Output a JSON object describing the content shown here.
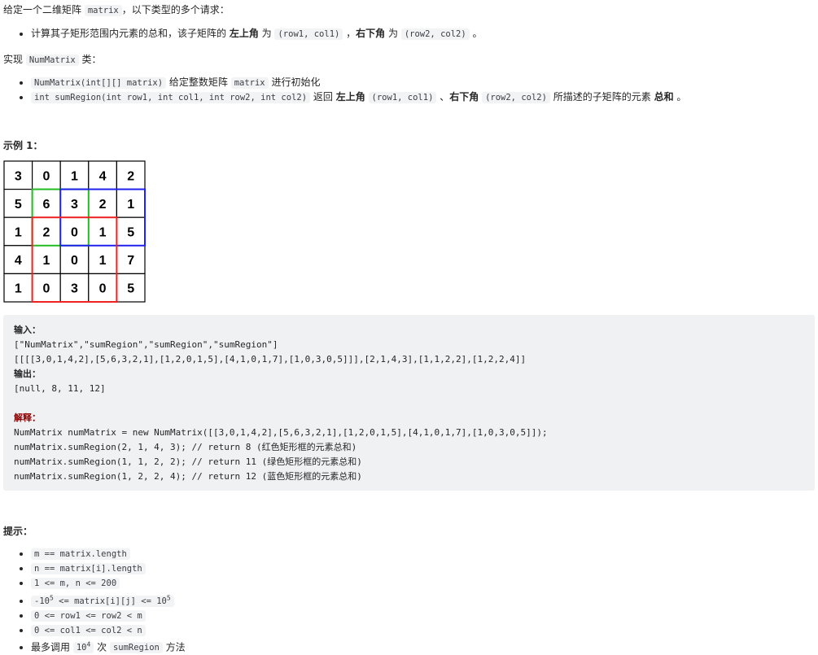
{
  "intro": {
    "pre": "给定一个二维矩阵 ",
    "code": "matrix",
    "post": "，以下类型的多个请求："
  },
  "req": {
    "t1": "计算其子矩形范围内元素的总和，该子矩阵的 ",
    "b1": "左上角",
    "t2": " 为 ",
    "c1": "(row1,  col1)",
    "t3": " ，",
    "b2": "右下角",
    "t4": " 为 ",
    "c2": "(row2,  col2)",
    "t5": " 。"
  },
  "impl": {
    "pre": "实现 ",
    "code": "NumMatrix",
    "post": " 类："
  },
  "methods": [
    {
      "code": "NumMatrix(int[][] matrix)",
      "t1": " 给定整数矩阵 ",
      "c2": "matrix",
      "t2": " 进行初始化"
    },
    {
      "code": "int sumRegion(int row1, int col1, int row2, int col2)",
      "t1": " 返回 ",
      "b1": "左上角",
      "c2": "(row1,  col1)",
      "t2": " 、",
      "b2": "右下角",
      "c3": "(row2,  col2)",
      "t3": " 所描述的子矩阵的元素 ",
      "b3": "总和",
      "t4": " 。"
    }
  ],
  "example_title": "示例 1：",
  "matrix": [
    [
      3,
      0,
      1,
      4,
      2
    ],
    [
      5,
      6,
      3,
      2,
      1
    ],
    [
      1,
      2,
      0,
      1,
      5
    ],
    [
      4,
      1,
      0,
      1,
      7
    ],
    [
      1,
      0,
      3,
      0,
      5
    ]
  ],
  "highlight_colors": {
    "green": "#22bb22",
    "blue": "#2222ee",
    "red": "#ee2222"
  },
  "example": {
    "input_label": "输入：",
    "input1": "[\"NumMatrix\",\"sumRegion\",\"sumRegion\",\"sumRegion\"]",
    "input2": "[[[[3,0,1,4,2],[5,6,3,2,1],[1,2,0,1,5],[4,1,0,1,7],[1,0,3,0,5]]],[2,1,4,3],[1,1,2,2],[1,2,2,4]]",
    "output_label": "输出：",
    "output": "[null, 8, 11, 12]",
    "explain_label": "解释：",
    "lines": [
      "NumMatrix numMatrix = new NumMatrix([[3,0,1,4,2],[5,6,3,2,1],[1,2,0,1,5],[4,1,0,1,7],[1,0,3,0,5]]);",
      "numMatrix.sumRegion(2, 1, 4, 3); // return 8 (红色矩形框的元素总和)",
      "numMatrix.sumRegion(1, 1, 2, 2); // return 11 (绿色矩形框的元素总和)",
      "numMatrix.sumRegion(1, 2, 2, 4); // return 12 (蓝色矩形框的元素总和)"
    ]
  },
  "hints_title": "提示：",
  "hints": [
    "m == matrix.length",
    "n == matrix[i].length",
    "1 <= m,  n <=  200"
  ],
  "hint4": {
    "a": "-10",
    "e1": "5",
    "b": "  <= matrix[i][j] <= 10",
    "e2": "5"
  },
  "hints2": [
    "0 <= row1 <= row2 < m",
    "0 <= col1 <= col2 < n"
  ],
  "hint7": {
    "t1": "最多调用 ",
    "c": "10",
    "e": "4",
    "t2": " 次 ",
    "c2": "sumRegion",
    "t3": " 方法"
  }
}
